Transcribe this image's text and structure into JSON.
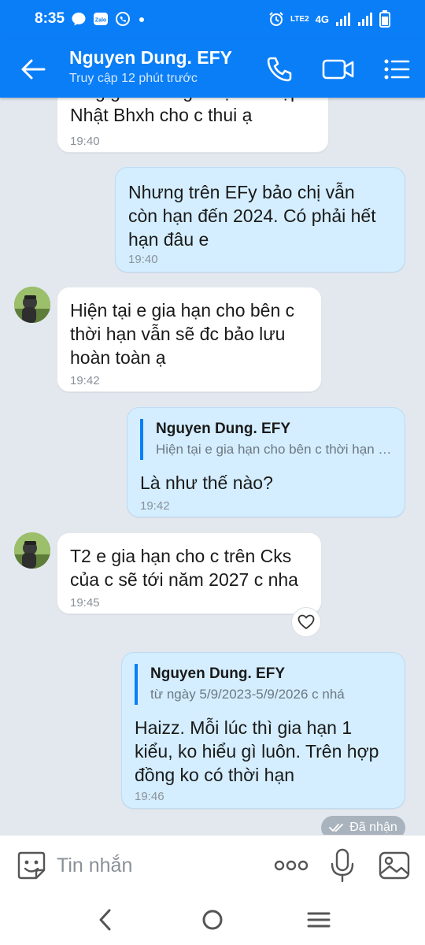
{
  "status_bar": {
    "time": "8:35",
    "network": "4G",
    "volte": "LTE2"
  },
  "header": {
    "contact_name": "Nguyen Dung. EFY",
    "contact_status": "Truy cập 12 phút trước"
  },
  "messages": [
    {
      "direction": "in",
      "text": "tăng gì ák chỉ gia hạn và cập\nNhật Bhxh cho c thui ạ",
      "time": "19:40"
    },
    {
      "direction": "out",
      "text": "Nhưng trên EFy bảo chị vẫn\ncòn hạn đến 2024. Có phải hết\nhạn đâu e",
      "time": "19:40"
    },
    {
      "direction": "in",
      "text": "Hiện tại e gia hạn cho bên c\nthời hạn vẫn sẽ đc bảo lưu\nhoàn toàn ạ",
      "time": "19:42"
    },
    {
      "direction": "out",
      "quote_name": "Nguyen Dung. EFY",
      "quote_text": "Hiện tại e gia hạn cho bên c thời hạn vẫn sẽ đc bảo lưu hoàn toàn ạ",
      "text": "Là như thế nào?",
      "time": "19:42"
    },
    {
      "direction": "in",
      "text": "T2 e gia hạn cho c trên Cks\ncủa c sẽ tới năm 2027 c nha",
      "time": "19:45"
    },
    {
      "direction": "out",
      "quote_name": "Nguyen Dung. EFY",
      "quote_text": "từ ngày 5/9/2023-5/9/2026 c nhá",
      "text": "Haizz. Mỗi lúc thì gia hạn 1\nkiểu, ko hiểu gì luôn. Trên hợp\nđồng ko có thời hạn",
      "time": "19:46"
    }
  ],
  "received_label": "Đã nhận",
  "composer": {
    "placeholder": "Tin nhắn"
  },
  "colors": {
    "header_blue": "#0a7ef7",
    "bubble_out": "#d4eeff",
    "bubble_in": "#ffffff",
    "chat_bg": "#e3e8ef"
  },
  "icons": [
    "back-arrow-icon",
    "phone-icon",
    "video-camera-icon",
    "list-menu-icon",
    "heart-icon",
    "double-check-icon",
    "sticker-emoji-icon",
    "more-dots-icon",
    "microphone-icon",
    "image-icon"
  ]
}
